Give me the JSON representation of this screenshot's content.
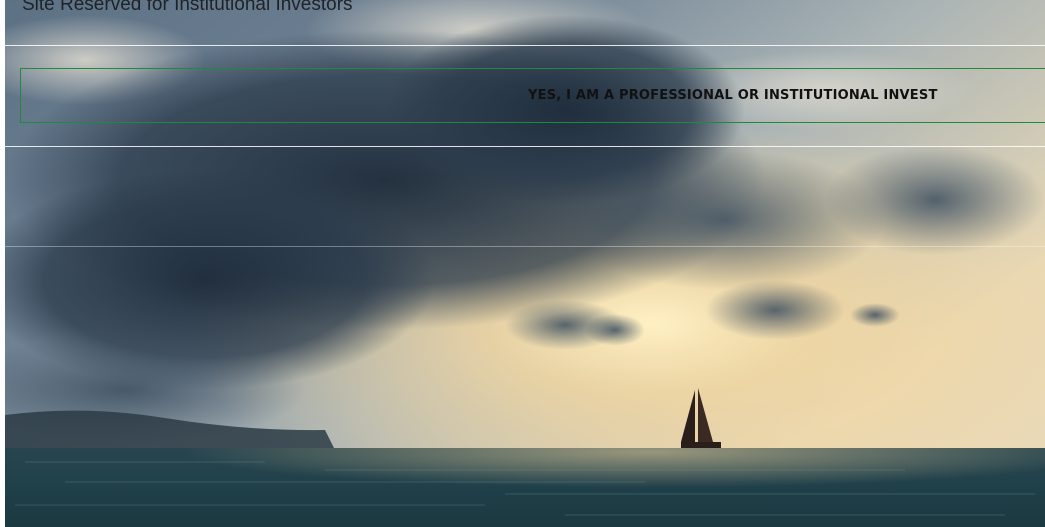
{
  "site": {
    "notice": "Site Reserved for Institutional Investors"
  },
  "confirm": {
    "label": "YES, I AM A PROFESSIONAL OR INSTITUTIONAL INVEST"
  },
  "colors": {
    "button_border": "#1f8a3c",
    "title_text": "#1f2328",
    "button_text": "#111111"
  }
}
